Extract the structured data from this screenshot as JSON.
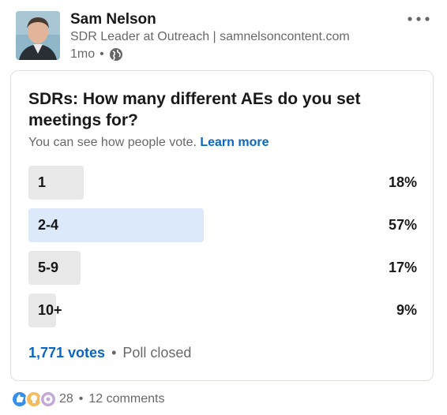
{
  "author": {
    "name": "Sam Nelson",
    "headline": "SDR Leader at Outreach | samnelsoncontent.com",
    "time": "1mo",
    "separator": "•"
  },
  "poll": {
    "question": "SDRs: How many different AEs do you set meetings for?",
    "note": "You can see how people vote.",
    "learn_more": "Learn more",
    "options": [
      {
        "label": "1",
        "percent_label": "18%",
        "share": 0.18,
        "selected": false
      },
      {
        "label": "2-4",
        "percent_label": "57%",
        "share": 0.57,
        "selected": true
      },
      {
        "label": "5-9",
        "percent_label": "17%",
        "share": 0.17,
        "selected": false
      },
      {
        "label": "10+",
        "percent_label": "9%",
        "share": 0.09,
        "selected": false
      }
    ],
    "votes": "1,771 votes",
    "dot": "•",
    "status": "Poll closed"
  },
  "social": {
    "reactions": [
      "like-icon",
      "insightful-icon",
      "curious-icon"
    ],
    "count": "28",
    "dot": "•",
    "comments": "12 comments"
  },
  "colors": {
    "link": "#0a66c2",
    "bar": "#e8e8e8",
    "bar_selected": "#dce9fb"
  }
}
